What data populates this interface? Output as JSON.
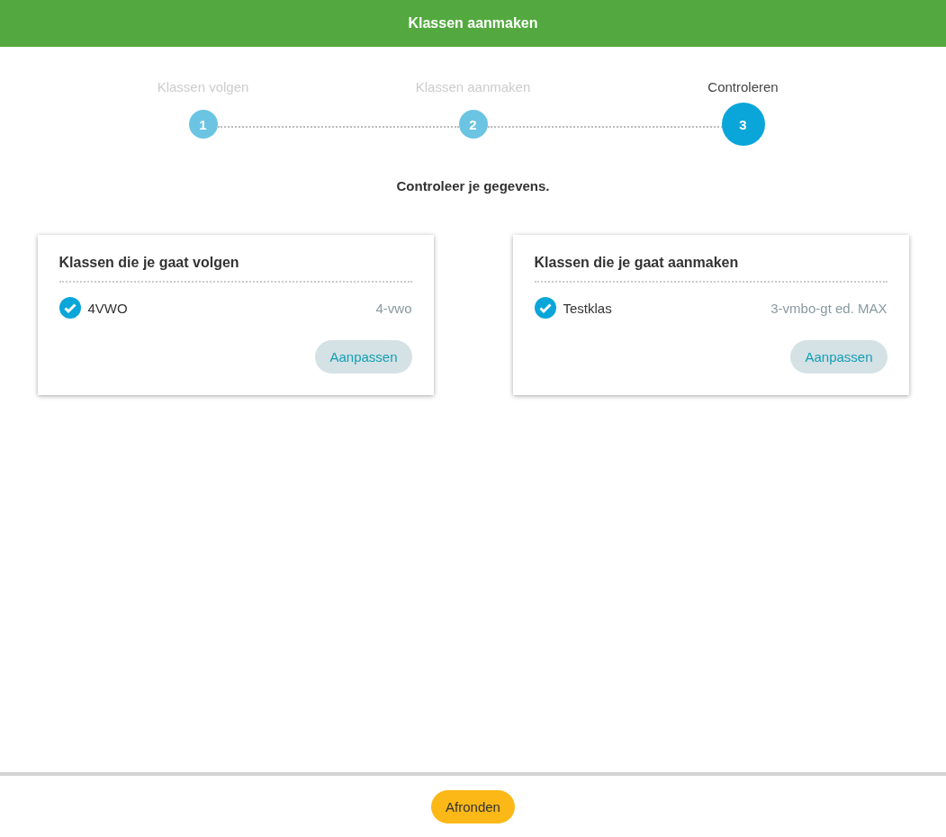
{
  "header": {
    "title": "Klassen aanmaken"
  },
  "steps": [
    {
      "label": "Klassen volgen",
      "number": "1",
      "selected": false
    },
    {
      "label": "Klassen aanmaken",
      "number": "2",
      "selected": false
    },
    {
      "label": "Controleren",
      "number": "3",
      "selected": true
    }
  ],
  "heading": "Controleer je gegevens.",
  "cards": [
    {
      "title": "Klassen die je gaat volgen",
      "items": [
        {
          "name": "4VWO",
          "detail": "4-vwo",
          "checked": true
        }
      ],
      "button": "Aanpassen"
    },
    {
      "title": "Klassen die je gaat aanmaken",
      "items": [
        {
          "name": "Testklas",
          "detail": "3-vmbo-gt ed. MAX",
          "checked": true
        }
      ],
      "button": "Aanpassen"
    }
  ],
  "footer": {
    "button": "Afronden"
  }
}
